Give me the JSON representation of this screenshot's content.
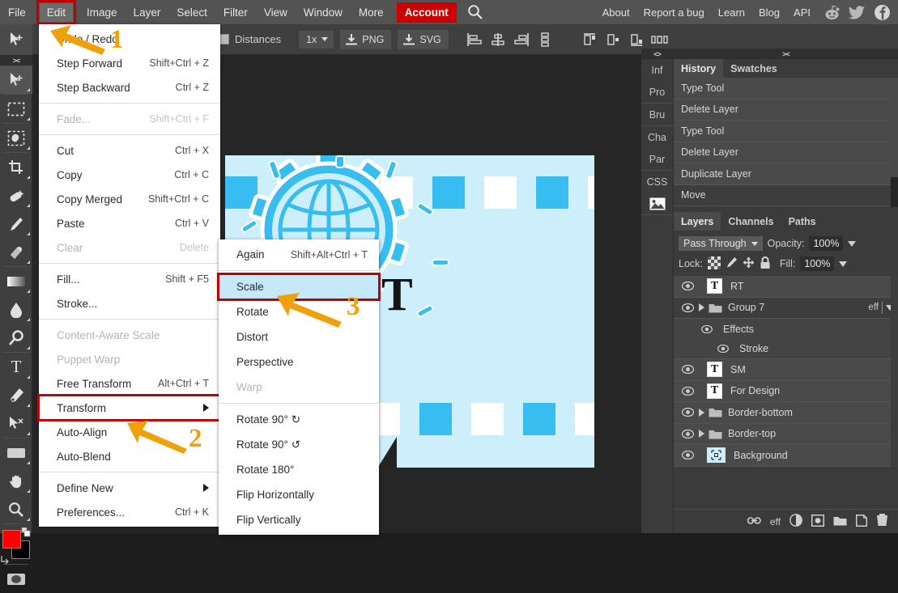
{
  "menubar": {
    "items": [
      {
        "label": "File",
        "name": "menu-file"
      },
      {
        "label": "Edit",
        "name": "menu-edit"
      },
      {
        "label": "Image",
        "name": "menu-image"
      },
      {
        "label": "Layer",
        "name": "menu-layer"
      },
      {
        "label": "Select",
        "name": "menu-select"
      },
      {
        "label": "Filter",
        "name": "menu-filter"
      },
      {
        "label": "View",
        "name": "menu-view"
      },
      {
        "label": "Window",
        "name": "menu-window"
      },
      {
        "label": "More",
        "name": "menu-more"
      }
    ],
    "account_label": "Account",
    "search_icon": "search-icon",
    "right_items": [
      {
        "label": "About"
      },
      {
        "label": "Report a bug"
      },
      {
        "label": "Learn"
      },
      {
        "label": "Blog"
      },
      {
        "label": "API"
      }
    ],
    "social": [
      {
        "name": "reddit-icon"
      },
      {
        "name": "twitter-icon"
      },
      {
        "name": "facebook-icon"
      }
    ]
  },
  "options_bar": {
    "distances_label": "Distances",
    "zoom_value": "1x",
    "png_label": "PNG",
    "svg_label": "SVG"
  },
  "toolbar": {
    "collapse_label": "><",
    "tools": [
      {
        "name": "move-tool",
        "glyph": "move"
      },
      {
        "name": "rectangular-marquee-tool",
        "glyph": "marquee"
      },
      {
        "name": "lasso-tool",
        "glyph": "lasso"
      },
      {
        "name": "crop-tool",
        "glyph": "crop"
      },
      {
        "name": "healing-brush-tool",
        "glyph": "heal"
      },
      {
        "name": "brush-tool",
        "glyph": "brush"
      },
      {
        "name": "eraser-tool",
        "glyph": "eraser"
      },
      {
        "name": "gradient-tool",
        "glyph": "gradient"
      },
      {
        "name": "blur-tool",
        "glyph": "blur"
      },
      {
        "name": "dodge-tool",
        "glyph": "dodge"
      },
      {
        "name": "type-tool",
        "glyph": "type"
      },
      {
        "name": "pen-tool",
        "glyph": "pen"
      },
      {
        "name": "path-select-tool",
        "glyph": "pathselect"
      },
      {
        "name": "shape-tool",
        "glyph": "shape"
      },
      {
        "name": "hand-tool",
        "glyph": "hand"
      },
      {
        "name": "zoom-tool",
        "glyph": "zoom"
      }
    ],
    "foreground_color": "#ff0000",
    "background_color": "#000000"
  },
  "edit_menu": {
    "items": [
      {
        "label": "Undo / Redo",
        "shortcut": "",
        "state": "normal"
      },
      {
        "label": "Step Forward",
        "shortcut": "Shift+Ctrl + Z",
        "state": "normal"
      },
      {
        "label": "Step Backward",
        "shortcut": "Ctrl + Z",
        "state": "normal"
      },
      {
        "label": "",
        "shortcut": "",
        "state": "separator"
      },
      {
        "label": "Fade...",
        "shortcut": "Shift+Ctrl + F",
        "state": "disabled"
      },
      {
        "label": "",
        "shortcut": "",
        "state": "separator"
      },
      {
        "label": "Cut",
        "shortcut": "Ctrl + X",
        "state": "normal"
      },
      {
        "label": "Copy",
        "shortcut": "Ctrl + C",
        "state": "normal"
      },
      {
        "label": "Copy Merged",
        "shortcut": "Shift+Ctrl + C",
        "state": "normal"
      },
      {
        "label": "Paste",
        "shortcut": "Ctrl + V",
        "state": "normal"
      },
      {
        "label": "Clear",
        "shortcut": "Delete",
        "state": "disabled"
      },
      {
        "label": "",
        "shortcut": "",
        "state": "separator"
      },
      {
        "label": "Fill...",
        "shortcut": "Shift + F5",
        "state": "normal"
      },
      {
        "label": "Stroke...",
        "shortcut": "",
        "state": "normal"
      },
      {
        "label": "",
        "shortcut": "",
        "state": "separator"
      },
      {
        "label": "Content-Aware Scale",
        "shortcut": "",
        "state": "disabled"
      },
      {
        "label": "Puppet Warp",
        "shortcut": "",
        "state": "disabled"
      },
      {
        "label": "Free Transform",
        "shortcut": "Alt+Ctrl + T",
        "state": "normal"
      },
      {
        "label": "Transform",
        "shortcut": "",
        "state": "submenu-boxed"
      },
      {
        "label": "Auto-Align",
        "shortcut": "",
        "state": "normal"
      },
      {
        "label": "Auto-Blend",
        "shortcut": "",
        "state": "normal"
      },
      {
        "label": "",
        "shortcut": "",
        "state": "separator"
      },
      {
        "label": "Define New",
        "shortcut": "",
        "state": "submenu"
      },
      {
        "label": "Preferences...",
        "shortcut": "Ctrl + K",
        "state": "normal"
      }
    ]
  },
  "transform_menu": {
    "items": [
      {
        "label": "Again",
        "shortcut": "Shift+Alt+Ctrl + T",
        "state": "normal"
      },
      {
        "label": "",
        "shortcut": "",
        "state": "separator"
      },
      {
        "label": "Scale",
        "shortcut": "",
        "state": "selected-boxed"
      },
      {
        "label": "Rotate",
        "shortcut": "",
        "state": "normal"
      },
      {
        "label": "Distort",
        "shortcut": "",
        "state": "normal"
      },
      {
        "label": "Perspective",
        "shortcut": "",
        "state": "normal"
      },
      {
        "label": "Warp",
        "shortcut": "",
        "state": "disabled"
      },
      {
        "label": "",
        "shortcut": "",
        "state": "separator"
      },
      {
        "label": "Rotate 90° ↻",
        "shortcut": "",
        "state": "normal"
      },
      {
        "label": "Rotate 90° ↺",
        "shortcut": "",
        "state": "normal"
      },
      {
        "label": "Rotate 180°",
        "shortcut": "",
        "state": "normal"
      },
      {
        "label": "Flip Horizontally",
        "shortcut": "",
        "state": "normal"
      },
      {
        "label": "Flip Vertically",
        "shortcut": "",
        "state": "normal"
      }
    ]
  },
  "right_dock": {
    "collapse_left": "<>",
    "collapse_right": "><",
    "rail_items": [
      {
        "label": "Inf",
        "name": "rail-info"
      },
      {
        "label": "Pro",
        "name": "rail-properties"
      },
      {
        "label": "Bru",
        "name": "rail-brushes"
      },
      {
        "label": "Cha",
        "name": "rail-character"
      },
      {
        "label": "Par",
        "name": "rail-paragraph"
      },
      {
        "label": "CSS",
        "name": "rail-css"
      },
      {
        "label": "",
        "name": "rail-image-icon"
      }
    ],
    "top_tabs": [
      {
        "label": "History",
        "active": true
      },
      {
        "label": "Swatches",
        "active": false
      }
    ],
    "history": [
      {
        "label": "Type Tool",
        "selected": false
      },
      {
        "label": "Delete Layer",
        "selected": false
      },
      {
        "label": "Type Tool",
        "selected": false
      },
      {
        "label": "Delete Layer",
        "selected": false
      },
      {
        "label": "Duplicate Layer",
        "selected": false
      },
      {
        "label": "Move",
        "selected": true
      }
    ],
    "layers_tabs": [
      {
        "label": "Layers",
        "active": true
      },
      {
        "label": "Channels",
        "active": false
      },
      {
        "label": "Paths",
        "active": false
      }
    ],
    "blend_mode": "Pass Through",
    "opacity_label": "Opacity:",
    "opacity_value": "100%",
    "lock_label": "Lock:",
    "fill_label": "Fill:",
    "fill_value": "100%",
    "layers": [
      {
        "label": "RT",
        "type": "text",
        "selected": false,
        "indent": 0
      },
      {
        "label": "Group 7",
        "type": "group",
        "selected": true,
        "indent": 0,
        "eff": "eff"
      },
      {
        "label": "Effects",
        "type": "effects",
        "selected": true,
        "indent": 1
      },
      {
        "label": "Stroke",
        "type": "effect-item",
        "selected": true,
        "indent": 2
      },
      {
        "label": "SM",
        "type": "text",
        "selected": false,
        "indent": 0
      },
      {
        "label": "For Design",
        "type": "text",
        "selected": false,
        "indent": 0
      },
      {
        "label": "Border-bottom",
        "type": "group",
        "selected": false,
        "indent": 0
      },
      {
        "label": "Border-top",
        "type": "group",
        "selected": false,
        "indent": 0
      },
      {
        "label": "Background",
        "type": "image",
        "selected": false,
        "indent": 0
      }
    ],
    "footer_icons": [
      {
        "name": "link-layers-icon"
      },
      {
        "name": "layer-effects-icon",
        "label": "eff"
      },
      {
        "name": "adjustment-layer-icon"
      },
      {
        "name": "layer-mask-icon"
      },
      {
        "name": "new-group-icon"
      },
      {
        "name": "new-layer-icon"
      },
      {
        "name": "delete-layer-icon"
      }
    ]
  },
  "canvas": {
    "letter": "T",
    "background_color": "#cdeefb",
    "accent_color": "#37bdf0"
  },
  "annotations": [
    {
      "number": "1",
      "target": "Undo / Redo"
    },
    {
      "number": "2",
      "target": "Transform"
    },
    {
      "number": "3",
      "target": "Scale"
    }
  ],
  "colors": {
    "highlight_red": "#c00000",
    "accent_orange": "#f0a10a",
    "account_red": "#cc0000",
    "selection_blue": "#c6e8fb"
  }
}
